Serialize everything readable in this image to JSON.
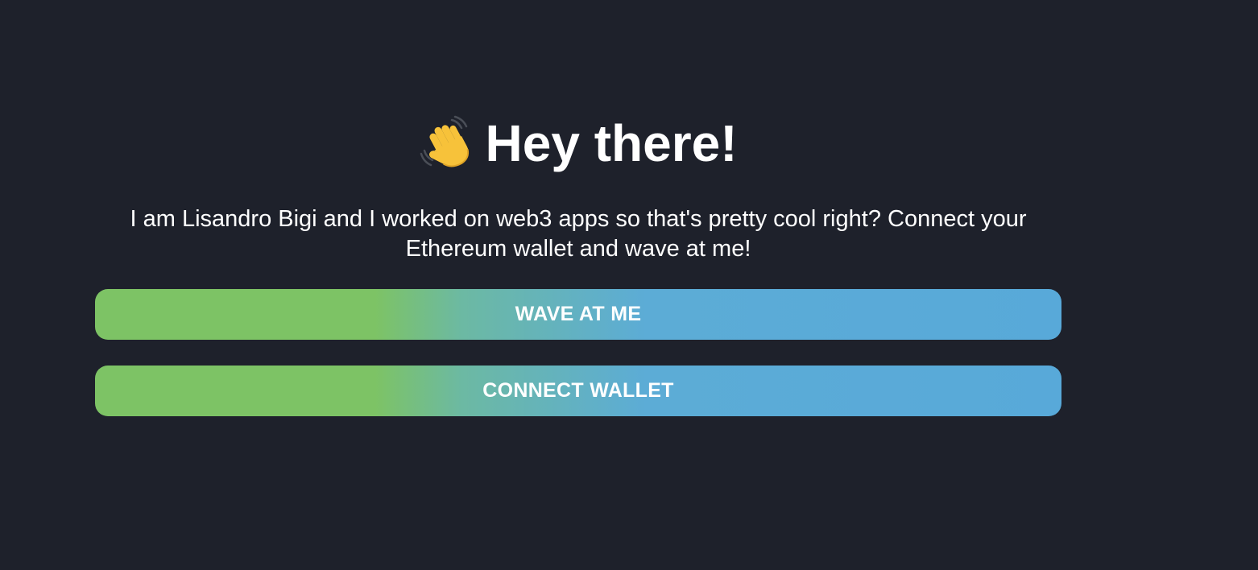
{
  "header": {
    "icon": "waving-hand-icon",
    "title": "Hey there!"
  },
  "bio": {
    "text": "I am Lisandro Bigi and I worked on web3 apps so that's pretty cool right? Connect your Ethereum wallet and wave at me!"
  },
  "buttons": {
    "wave_label": "WAVE AT ME",
    "connect_label": "CONNECT WALLET"
  },
  "colors": {
    "background": "#1e212b",
    "text": "#ffffff",
    "gradient_start": "#7dc365",
    "gradient_end": "#58a9d9",
    "hand": "#f7c23a"
  }
}
